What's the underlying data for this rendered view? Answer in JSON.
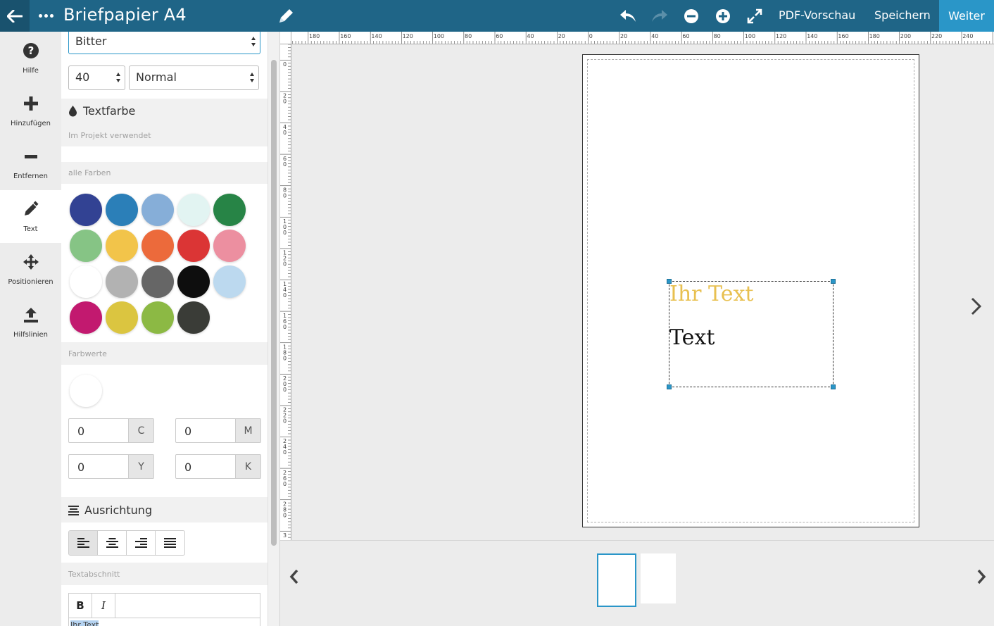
{
  "topbar": {
    "title": "Briefpapier A4",
    "back_icon": "arrow-left-icon",
    "menu_icon": "more-dots-icon",
    "edit_icon": "pencil-icon",
    "undo_icon": "undo-icon",
    "redo_icon": "redo-icon",
    "zoom_out_icon": "zoom-out-icon",
    "zoom_in_icon": "zoom-in-icon",
    "fullscreen_icon": "expand-icon",
    "pdf_preview_label": "PDF-Vorschau",
    "save_label": "Speichern",
    "next_label": "Weiter",
    "colors": {
      "bar": "#1f6587",
      "back": "#19526e",
      "accent": "#2a96c8"
    }
  },
  "rail": {
    "items": [
      {
        "label": "Hilfe",
        "icon": "help-icon"
      },
      {
        "label": "Hinzufügen",
        "icon": "plus-icon"
      },
      {
        "label": "Entfernen",
        "icon": "minus-icon"
      },
      {
        "label": "Text",
        "icon": "pencil-icon",
        "active": true
      },
      {
        "label": "Positionieren",
        "icon": "move-icon"
      },
      {
        "label": "Hilfslinien",
        "icon": "upload-icon"
      }
    ]
  },
  "panel": {
    "font_family": "Bitter",
    "font_size": "40",
    "font_weight": "Normal",
    "text_color_heading": "Textfarbe",
    "used_in_project_label": "Im Projekt verwendet",
    "all_colors_label": "alle Farben",
    "swatches": [
      "#324293",
      "#2b7fb8",
      "#86aed8",
      "#e2f4f2",
      "#278446",
      "#86c485",
      "#f2c44a",
      "#ec6a3b",
      "#db3535",
      "#ec8fa0",
      "#ffffff",
      "#b2b2b2",
      "#666666",
      "#0e0e0e",
      "#bcd9ef",
      "#c2196f",
      "#dbc540",
      "#8cb944",
      "#3a3c37"
    ],
    "color_values_label": "Farbwerte",
    "selected_color": "#ffffff",
    "cmyk": {
      "c": {
        "value": "0",
        "unit": "C"
      },
      "m": {
        "value": "0",
        "unit": "M"
      },
      "y": {
        "value": "0",
        "unit": "Y"
      },
      "k": {
        "value": "0",
        "unit": "K"
      }
    },
    "alignment_heading": "Ausrichtung",
    "alignment_options": [
      "align-left-icon",
      "align-center-icon",
      "align-right-icon",
      "align-justify-icon"
    ],
    "alignment_selected": "left",
    "text_section_label": "Textabschnitt",
    "editor": {
      "bold_label": "B",
      "italic_label": "I",
      "content": "Ihr Text"
    }
  },
  "ruler": {
    "h_labels": [
      "180",
      "160",
      "140",
      "120",
      "100",
      "80",
      "60",
      "40",
      "20",
      "0",
      "20",
      "40",
      "60",
      "80",
      "100",
      "120",
      "140",
      "160",
      "180",
      "200",
      "220",
      "240"
    ],
    "v_labels": [
      "0",
      "20",
      "40",
      "60",
      "80",
      "100",
      "120",
      "140",
      "160",
      "180",
      "200",
      "220",
      "240",
      "260",
      "280",
      "3"
    ]
  },
  "canvas": {
    "textbox": {
      "line1": "Ihr Text",
      "line2": "Text"
    },
    "next_page_icon": "chevron-right-icon"
  },
  "pages": {
    "prev_icon": "chevron-left-icon",
    "next_icon": "chevron-right-icon",
    "count": 2,
    "active": 1
  }
}
